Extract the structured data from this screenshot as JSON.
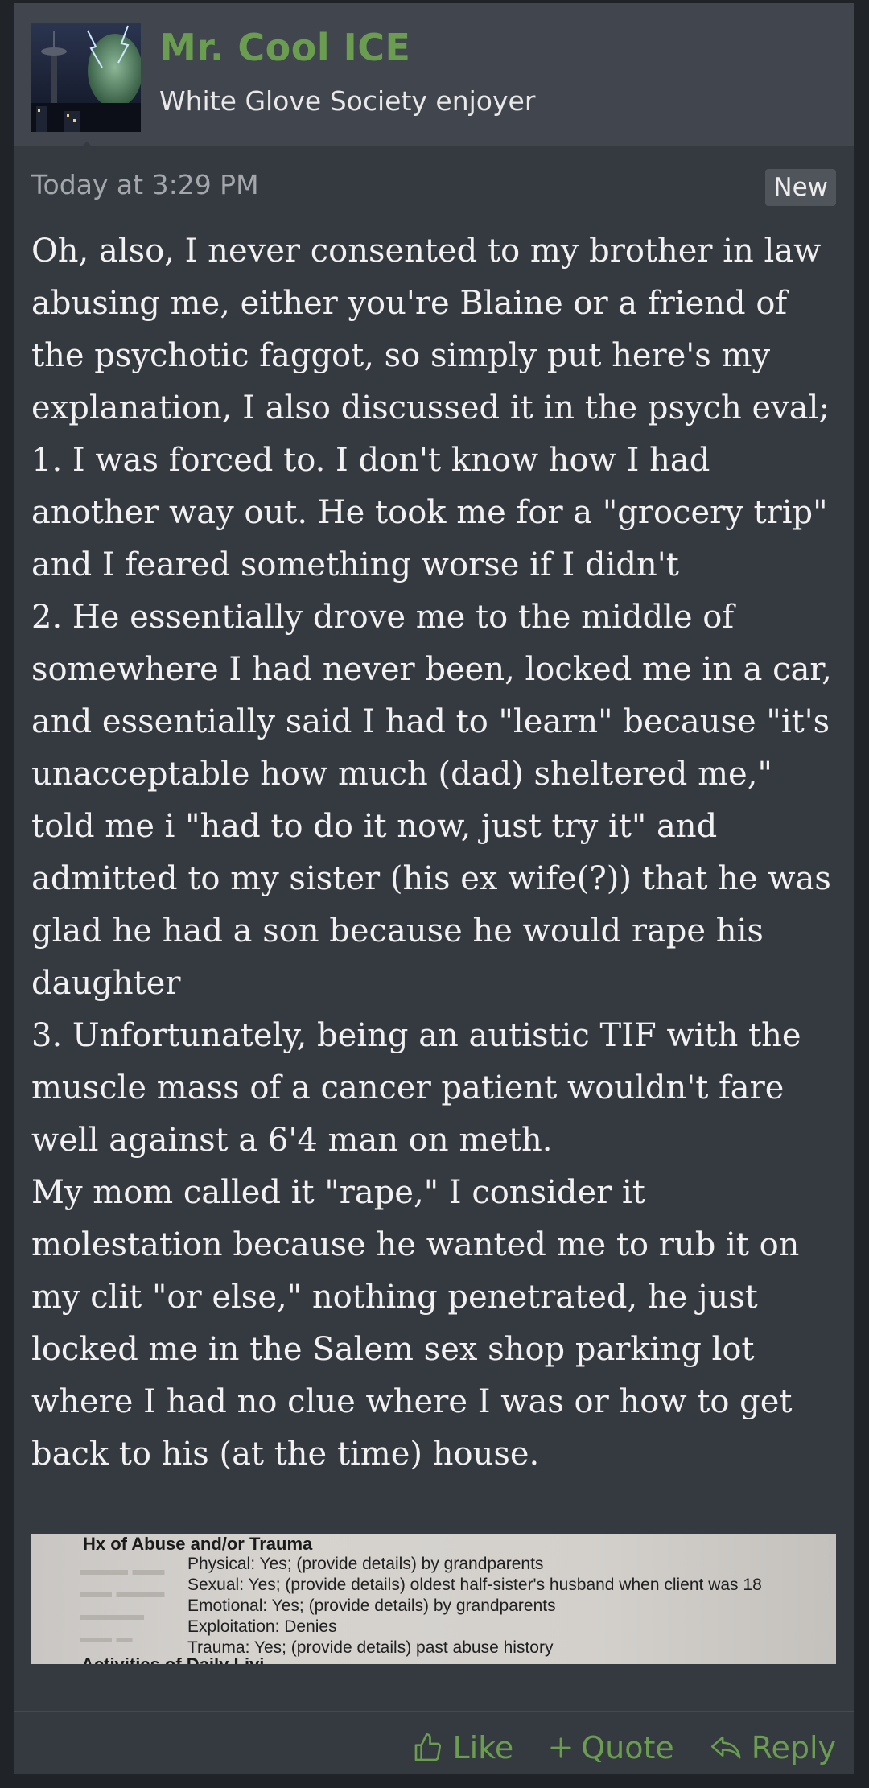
{
  "post": {
    "username": "Mr. Cool ICE",
    "user_title": "White Glove Society enjoyer",
    "timestamp": "Today at 3:29 PM",
    "badge": "New",
    "body": "Oh, also, I never consented to my brother in law abusing me, either you're Blaine or a friend of the psychotic faggot, so simply put here's my explanation, I also discussed it in the psych eval;\n1. I was forced to. I don't know how I had another way out. He took me for a \"grocery trip\" and I feared something worse if I didn't\n2. He essentially drove me to the middle of somewhere I had never been, locked me in a car, and essentially said I had to \"learn\" because \"it's unacceptable how much (dad) sheltered me,\" told me i \"had to do it now, just try it\" and admitted to my sister (his ex wife(?)) that he was glad he had a son because he would rape his daughter\n3. Unfortunately, being an autistic TIF with the muscle mass of a cancer patient wouldn't fare well against a 6'4 man on meth.\nMy mom called it \"rape,\" I consider it molestation because he wanted me to rub it on my clit \"or else,\" nothing penetrated, he just locked me in the Salem sex shop parking lot where I had no clue where I was or how to get back to his (at the time) house.",
    "attachment": {
      "heading": "Hx of Abuse and/or Trauma",
      "lines": [
        "Physical: Yes; (provide details) by grandparents",
        "Sexual: Yes; (provide details) oldest half-sister's husband when client was 18",
        "Emotional: Yes; (provide details) by grandparents",
        "Exploitation: Denies",
        "Trauma: Yes; (provide details) past abuse history"
      ],
      "cutoff_heading": "Activities of Daily Livi..."
    },
    "actions": {
      "like": "Like",
      "quote": "Quote",
      "reply": "Reply"
    }
  },
  "colors": {
    "accent": "#6a9d4f",
    "post_bg": "#353940",
    "header_bg": "#41454d",
    "page_bg": "#202328"
  },
  "icons": [
    "thumbs-up-icon",
    "plus-icon",
    "reply-arrow-icon"
  ]
}
